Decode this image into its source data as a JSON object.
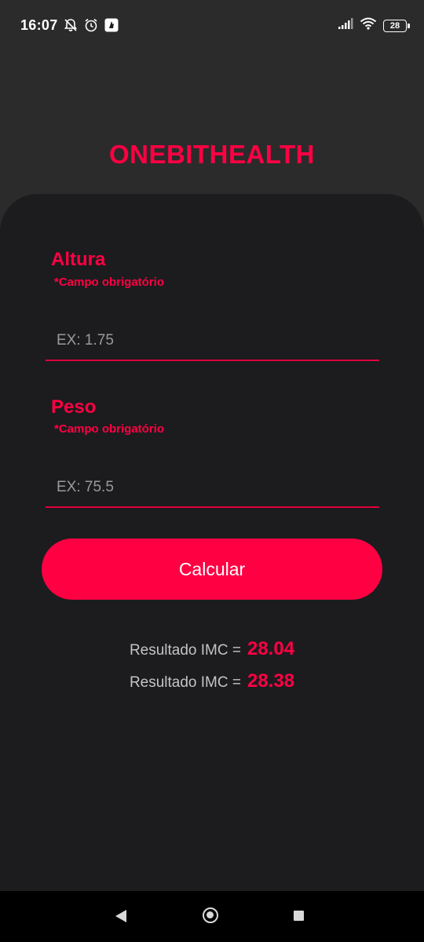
{
  "status_bar": {
    "time": "16:07",
    "battery_level": "28",
    "icons_left": [
      "bell-off-icon",
      "alarm-icon",
      "app-notification-icon"
    ],
    "icons_right": [
      "signal-icon",
      "wifi-icon",
      "battery-icon"
    ]
  },
  "app": {
    "title": "ONEBITHEALTH"
  },
  "form": {
    "height": {
      "label": "Altura",
      "required_text": "*Campo obrigatório",
      "value": "",
      "placeholder": "EX: 1.75"
    },
    "weight": {
      "label": "Peso",
      "required_text": "*Campo obrigatório",
      "value": "",
      "placeholder": "EX: 75.5"
    },
    "calculate_label": "Calcular"
  },
  "results": [
    {
      "label": "Resultado IMC =",
      "value": "28.04"
    },
    {
      "label": "Resultado IMC =",
      "value": "28.38"
    }
  ],
  "nav_bar": {
    "icons": [
      "back-icon",
      "home-icon",
      "recents-icon"
    ]
  },
  "colors": {
    "accent": "#ff0043",
    "background_top": "#2b2b2b",
    "panel": "#1c1c1e"
  }
}
